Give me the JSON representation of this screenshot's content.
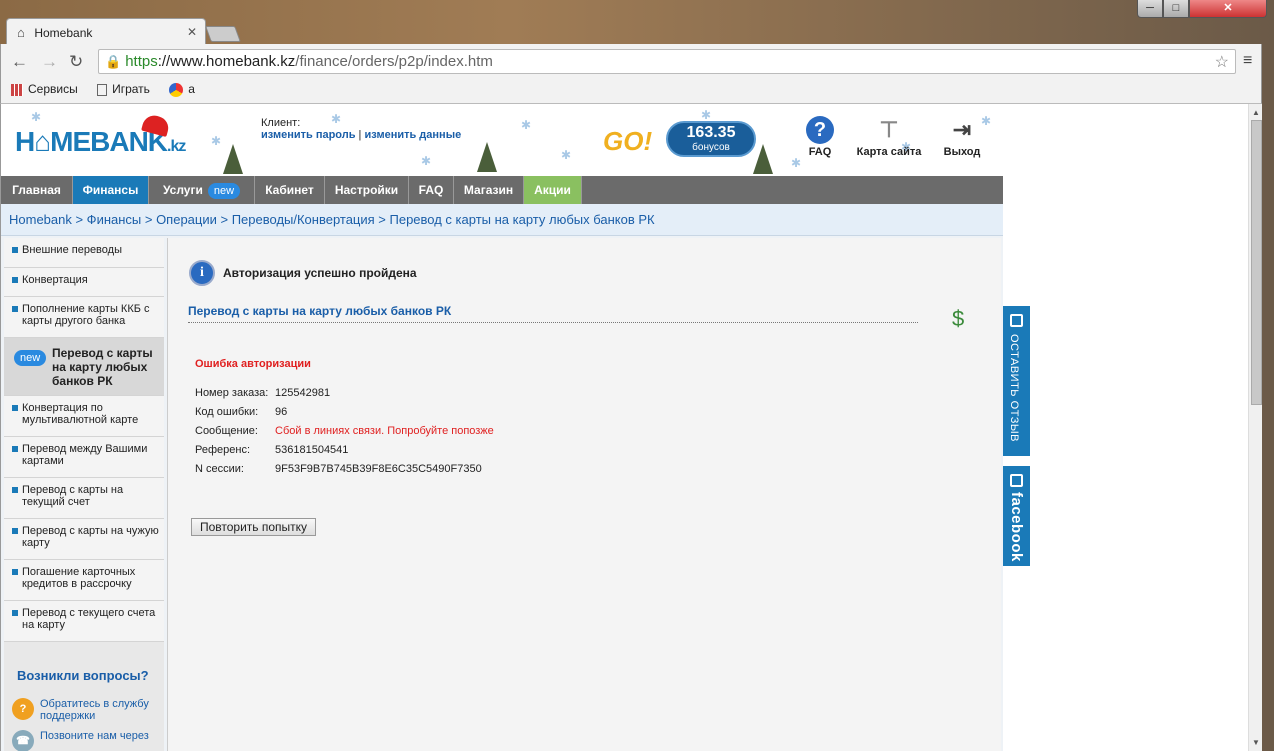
{
  "browser": {
    "tab_title": "Homebank",
    "tab_icon": "home-icon",
    "url_https": "https",
    "url_domain": "://www.homebank.kz",
    "url_path": "/finance/orders/p2p/index.htm",
    "window_min": "─",
    "window_max": "□",
    "window_close": "✕",
    "bookmarks": [
      "Сервисы",
      "Играть",
      "a"
    ]
  },
  "header": {
    "logo_main": "H⌂MEBANK",
    "logo_suffix": ".kz",
    "client_label": "Клиент:",
    "change_password": "изменить пароль",
    "separator": " | ",
    "change_data": "изменить данные",
    "go_logo": "GO!",
    "bonus_value": "163.35",
    "bonus_label": "бонусов",
    "faq_label": "FAQ",
    "sitemap_label": "Карта сайта",
    "exit_label": "Выход"
  },
  "nav": {
    "items": [
      "Главная",
      "Финансы",
      "Услуги",
      "Кабинет",
      "Настройки",
      "FAQ",
      "Магазин",
      "Акции"
    ],
    "new_badge": "new"
  },
  "breadcrumb": "Homebank > Финансы > Операции > Переводы/Конвертация > Перевод с карты на карту любых банков РК",
  "sidebar": {
    "items": [
      "Внешние переводы",
      "Конвертация",
      "Пополнение карты ККБ с карты другого банка",
      "Перевод с карты на карту любых банков РК",
      "Конвертация по мультивалютной карте",
      "Перевод между Вашими картами",
      "Перевод с карты на текущий счет",
      "Перевод с карты на чужую карту",
      "Погашение карточных кредитов в рассрочку",
      "Перевод с текущего счета на карту"
    ],
    "new_badge": "new",
    "questions_title": "Возникли вопросы?",
    "help_support": "Обратитесь в службу поддержки",
    "help_call": "Позвоните нам через"
  },
  "main": {
    "auth_message": "Авторизация успешно пройдена",
    "section_title": "Перевод с карты на карту любых банков РК",
    "error_title": "Ошибка авторизации",
    "rows": [
      {
        "label": "Номер заказа:",
        "value": "125542981"
      },
      {
        "label": "Код ошибки:",
        "value": "96"
      },
      {
        "label": "Сообщение:",
        "value": "Сбой в линиях связи. Попробуйте попозже"
      },
      {
        "label": "Референс:",
        "value": "536181504541"
      },
      {
        "label": "N сессии:",
        "value": "9F53F9B7B745B39F8E6C35C5490F7350"
      }
    ],
    "retry_button": "Повторить попытку"
  },
  "side_tabs": {
    "feedback": "ОСТАВИТЬ ОТЗЫВ",
    "facebook": "facebook"
  },
  "colors": {
    "brand_blue": "#1a7ab8",
    "error_red": "#e02020",
    "nav_gray": "#6b6b6b",
    "promo_green": "#8ac060"
  }
}
